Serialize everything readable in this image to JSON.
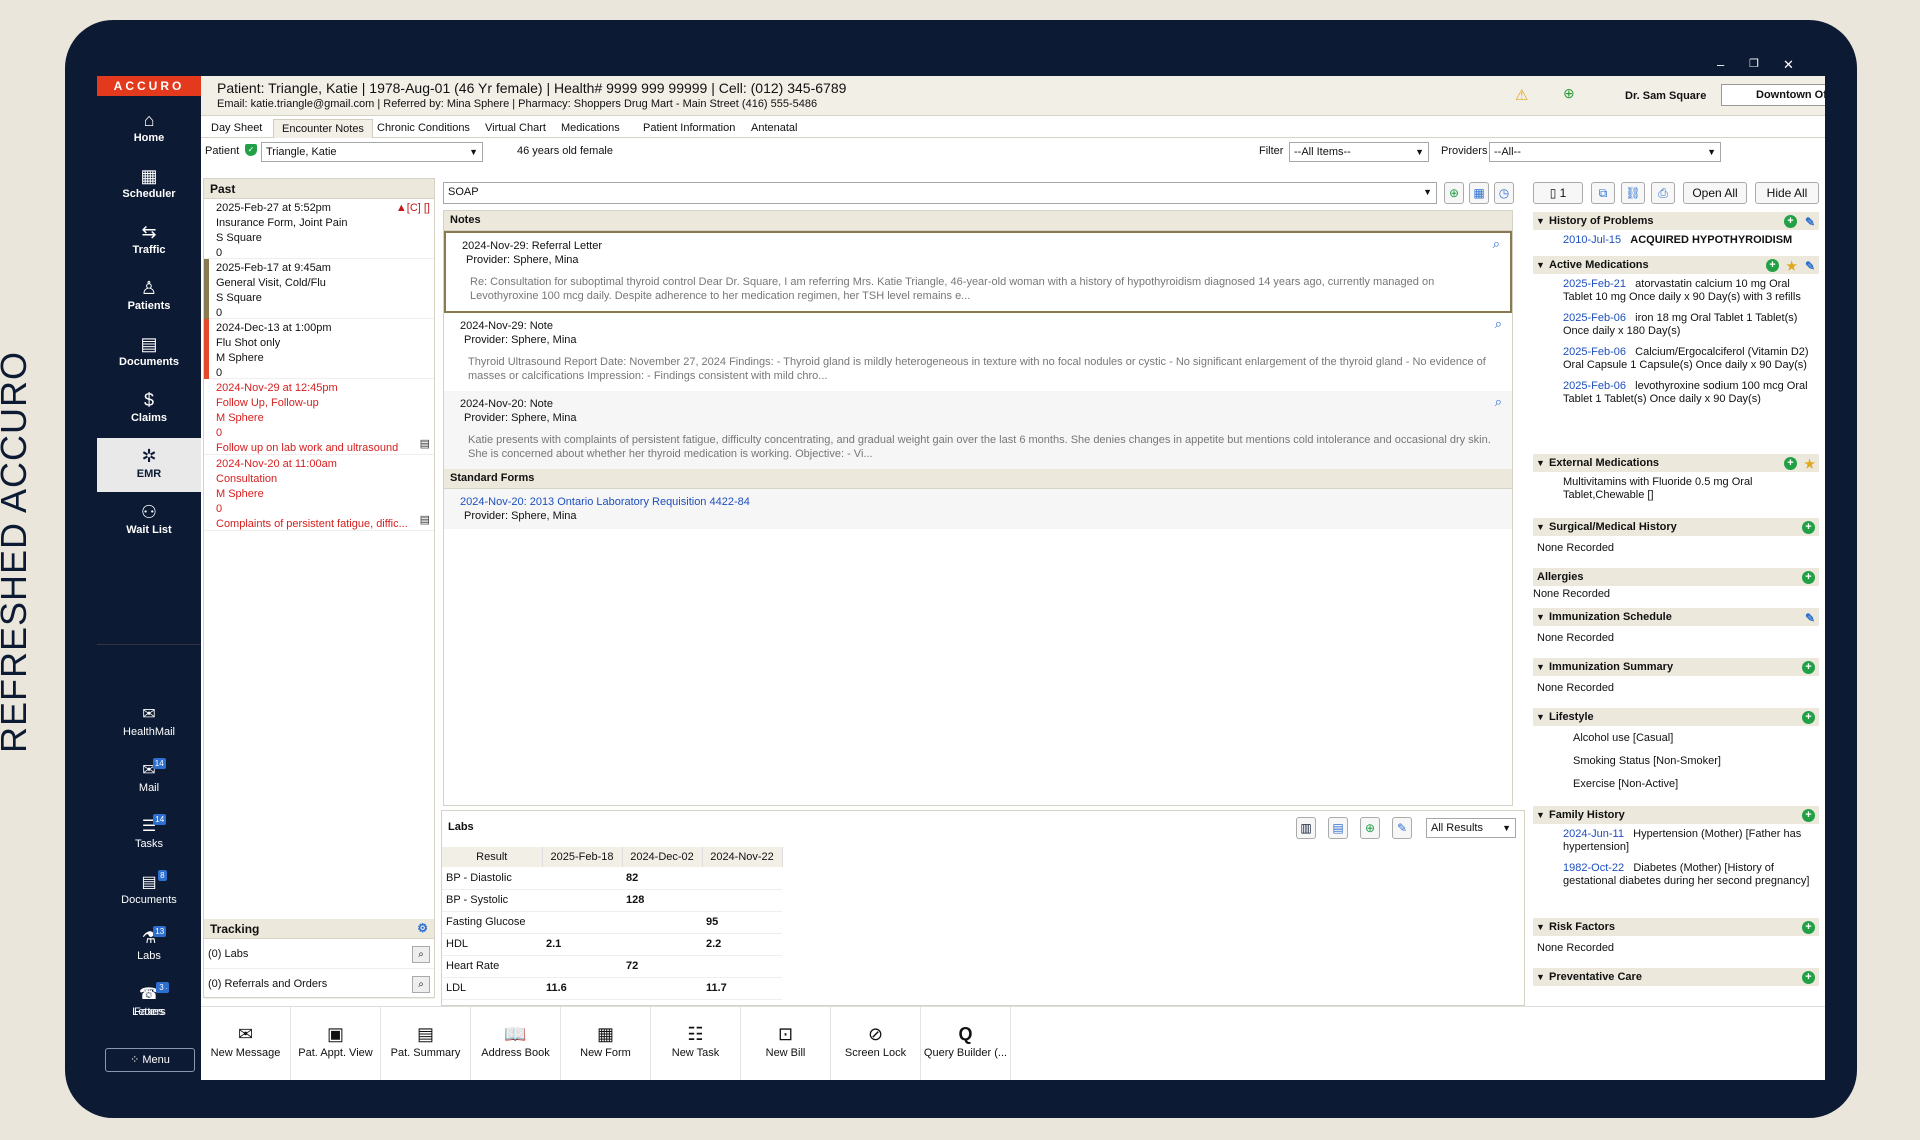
{
  "caption": "REFRESHED ACCURO",
  "window": {
    "min": "–",
    "max": "❐",
    "close": "✕"
  },
  "logo": "ACCURO",
  "nav": [
    {
      "label": "Home",
      "icon": "⌂"
    },
    {
      "label": "Scheduler",
      "icon": "▦"
    },
    {
      "label": "Traffic",
      "icon": "⇆"
    },
    {
      "label": "Patients",
      "icon": "♙"
    },
    {
      "label": "Documents",
      "icon": "▤"
    },
    {
      "label": "Claims",
      "icon": "$"
    },
    {
      "label": "EMR",
      "icon": "✲"
    },
    {
      "label": "Wait List",
      "icon": "⚇"
    }
  ],
  "nav2": [
    {
      "label": "HealthMail",
      "icon": "✉",
      "badge": ""
    },
    {
      "label": "Mail",
      "icon": "✉",
      "badge": "14"
    },
    {
      "label": "Tasks",
      "icon": "☰",
      "badge": "14"
    },
    {
      "label": "Documents",
      "icon": "▤",
      "badge": "8"
    },
    {
      "label": "Labs",
      "icon": "⚗",
      "badge": "13"
    },
    {
      "label": "Faxes",
      "icon": "☎",
      "badge": "14"
    },
    {
      "label": "Letters",
      "icon": "✎",
      "badge": "3"
    }
  ],
  "menu": "⁘ Menu",
  "header": {
    "patient": "Patient: Triangle, Katie | 1978-Aug-01 (46 Yr female) | Health# 9999 999 99999 | Cell: (012) 345-6789",
    "sub": "Email: katie.triangle@gmail.com | Referred by: Mina Sphere | Pharmacy: Shoppers Drug Mart - Main Street (416) 555-5486",
    "doctor": "Dr. Sam Square",
    "office": "Downtown Office - ON - TS"
  },
  "tabs": [
    "Day Sheet",
    "Encounter Notes",
    "Chronic Conditions",
    "Virtual Chart",
    "Medications",
    "Patient Information",
    "Antenatal"
  ],
  "pbar": {
    "patient_label": "Patient",
    "patient_value": "Triangle, Katie",
    "age": "46 years old female",
    "filter_label": "Filter",
    "filter_value": "--All Items--",
    "providers_label": "Providers",
    "providers_value": "--All--"
  },
  "past": {
    "title": "Past",
    "entries": [
      {
        "date": "2025-Feb-27 at 5:52pm",
        "l1": "Insurance Form, Joint Pain",
        "l2": "S Square",
        "l3": "0",
        "flag": "▲[C] []"
      },
      {
        "date": "2025-Feb-17 at 9:45am",
        "l1": "General Visit, Cold/Flu",
        "l2": "S Square",
        "l3": "0",
        "flag": ""
      },
      {
        "date": "2024-Dec-13 at 1:00pm",
        "l1": "Flu Shot only",
        "l2": "M Sphere",
        "l3": "0",
        "flag": ""
      },
      {
        "date": "2024-Nov-29 at 12:45pm",
        "l1": "Follow Up, Follow-up",
        "l2": "M Sphere",
        "l3": "0",
        "l4": "Follow up on lab work and ultrasound",
        "flag": ""
      },
      {
        "date": "2024-Nov-20 at 11:00am",
        "l1": "Consultation",
        "l2": "M Sphere",
        "l3": "0",
        "l4": "Complaints of persistent fatigue, diffic...",
        "flag": ""
      }
    ],
    "tracking": "Tracking",
    "labs": "(0) Labs",
    "referrals": "(0) Referrals and Orders"
  },
  "notes": {
    "template": "SOAP",
    "header": "Notes",
    "items": [
      {
        "title": "2024-Nov-29: Referral Letter",
        "provider": "Provider: Sphere, Mina",
        "body": "Re: Consultation for suboptimal thyroid control    Dear Dr. Square,     I am referring Mrs. Katie Triangle, 46-year-old woman with a history of hypothyroidism diagnosed 14 years ago, currently managed on Levothyroxine 100 mcg daily. Despite adherence to her medication regimen, her TSH level remains e..."
      },
      {
        "title": "2024-Nov-29: Note",
        "provider": "Provider: Sphere, Mina",
        "body": "Thyroid Ultrasound Report    Date: November 27, 2024    Findings:  -   Thyroid gland is mildly heterogeneous in texture with no focal nodules or cystic   -   No significant enlargement of the thyroid gland   -   No evidence of masses or calcifications    Impression:  -   Findings consistent with mild chro..."
      },
      {
        "title": "2024-Nov-20: Note",
        "provider": "Provider: Sphere, Mina",
        "body": "Katie presents with complaints of persistent fatigue, difficulty concentrating, and gradual weight gain over the last 6 months. She denies changes in appetite but mentions cold intolerance and occasional dry skin. She is concerned about whether her thyroid medication is working.    Objective:  -   Vi..."
      }
    ],
    "forms_header": "Standard Forms",
    "form_link": "2024-Nov-20: 2013 Ontario Laboratory Requisition 4422-84",
    "form_provider": "Provider: Sphere, Mina"
  },
  "labs": {
    "title": "Labs",
    "filter": "All Results",
    "cols": [
      "Result",
      "2025-Feb-18",
      "2024-Dec-02",
      "2024-Nov-22"
    ],
    "rows": [
      [
        "BP - Diastolic",
        "",
        "82",
        ""
      ],
      [
        "BP - Systolic",
        "",
        "128",
        ""
      ],
      [
        "Fasting Glucose",
        "",
        "",
        "95"
      ],
      [
        "HDL",
        "2.1",
        "",
        "2.2"
      ],
      [
        "Heart Rate",
        "",
        "72",
        ""
      ],
      [
        "LDL",
        "11.6",
        "",
        "11.7"
      ]
    ]
  },
  "right": {
    "count": "1",
    "open_all": "Open All",
    "hide_all": "Hide All",
    "problems": {
      "title": "History of Problems",
      "date": "2010-Jul-15",
      "text": "ACQUIRED HYPOTHYROIDISM"
    },
    "active_meds": {
      "title": "Active Medications",
      "items": [
        {
          "date": "2025-Feb-21",
          "text": "atorvastatin calcium 10 mg Oral Tablet 10 mg Once daily x 90 Day(s) with 3 refills"
        },
        {
          "date": "2025-Feb-06",
          "text": "iron 18 mg Oral Tablet 1 Tablet(s) Once daily x 180 Day(s)"
        },
        {
          "date": "2025-Feb-06",
          "text": "Calcium/Ergocalciferol (Vitamin D2) Oral Capsule 1 Capsule(s) Once daily x 90 Day(s)"
        },
        {
          "date": "2025-Feb-06",
          "text": "levothyroxine sodium 100 mcg Oral Tablet 1 Tablet(s) Once daily x 90 Day(s)"
        }
      ]
    },
    "external": {
      "title": "External Medications",
      "text": "Multivitamins with Fluoride 0.5 mg Oral Tablet,Chewable []"
    },
    "surgical": {
      "title": "Surgical/Medical History",
      "none": "None Recorded"
    },
    "allergies": {
      "title": "Allergies",
      "none": "None Recorded"
    },
    "imm_sched": {
      "title": "Immunization Schedule",
      "none": "None Recorded"
    },
    "imm_sum": {
      "title": "Immunization Summary",
      "none": "None Recorded"
    },
    "lifestyle": {
      "title": "Lifestyle",
      "alcohol": "Alcohol use [Casual]",
      "smoking": "Smoking Status [Non-Smoker]",
      "exercise": "Exercise [Non-Active]"
    },
    "family": {
      "title": "Family History",
      "items": [
        {
          "date": "2024-Jun-11",
          "text": "Hypertension (Mother) [Father has hypertension]"
        },
        {
          "date": "1982-Oct-22",
          "text": "Diabetes (Mother) [History of gestational diabetes during her second pregnancy]"
        }
      ]
    },
    "risk": {
      "title": "Risk Factors",
      "none": "None Recorded"
    },
    "preventive": {
      "title": "Preventative Care"
    }
  },
  "bottom": [
    {
      "label": "New Message",
      "icon": "✉"
    },
    {
      "label": "Pat. Appt. View",
      "icon": "▣"
    },
    {
      "label": "Pat. Summary",
      "icon": "▤"
    },
    {
      "label": "Address Book",
      "icon": "📖"
    },
    {
      "label": "New Form",
      "icon": "▦"
    },
    {
      "label": "New Task",
      "icon": "☷"
    },
    {
      "label": "New Bill",
      "icon": "⊡"
    },
    {
      "label": "Screen Lock",
      "icon": "⊘"
    },
    {
      "label": "Query Builder (...",
      "icon": "Q"
    }
  ]
}
